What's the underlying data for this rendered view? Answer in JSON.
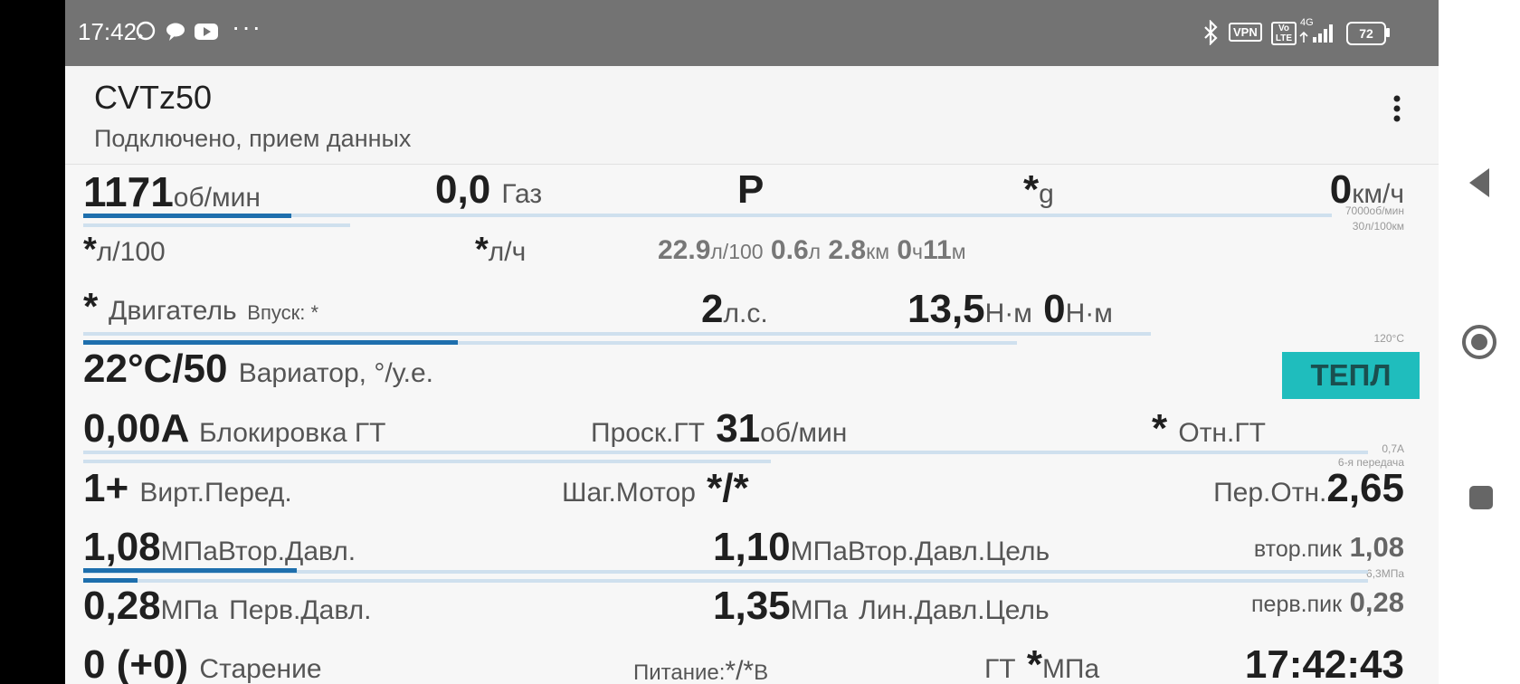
{
  "status": {
    "time": "17:42",
    "vpn": "VPN",
    "volte": "Vo LTE",
    "net": "4G",
    "battery": "72"
  },
  "app": {
    "title": "CVTz50",
    "subtitle": "Подключено, прием данных"
  },
  "row1": {
    "rpm": "1171",
    "rpm_unit": "об/мин",
    "gas": "0,0",
    "gas_label": "Газ",
    "gear": "P",
    "g_val": "*",
    "g_unit": "g",
    "speed": "0",
    "speed_unit": "км/ч",
    "scale1": "7000об/мин",
    "scale2": "30л/100км",
    "rpm_fill": 0.167
  },
  "row2": {
    "cons1": "*",
    "cons1_unit": "л/100",
    "cons2": "*",
    "cons2_unit": "л/ч",
    "trip_cons": "22.9",
    "trip_cons_unit": "л/100",
    "trip_fuel": "0.6",
    "trip_fuel_unit": "л",
    "trip_dist": "2.8",
    "trip_dist_unit": "км",
    "trip_h": "0",
    "trip_h_unit": "ч",
    "trip_m": "11",
    "trip_m_unit": "м"
  },
  "row3": {
    "engine_val": "*",
    "engine_label": "Двигатель",
    "intake": "Впуск: *",
    "hp": "2",
    "hp_unit": "л.с.",
    "torque": "13,5",
    "torque_unit": "Н·м",
    "torque2": "0",
    "torque2_unit": "Н·м",
    "scale": "120°C",
    "fill": 0.3
  },
  "row4": {
    "cvt_temp": "22°C/50",
    "cvt_label": "Вариатор, °/у.е.",
    "badge": "ТЕПЛ",
    "badge_color": "#1fbdbd"
  },
  "row5": {
    "lock_val": "0,00A",
    "lock_label": "Блокировка ГТ",
    "slip_label": "Проск.ГТ",
    "slip_val": "31",
    "slip_unit": "об/мин",
    "ratio_val": "*",
    "ratio_label": "Отн.ГТ",
    "scale1": "0,7A",
    "scale2": "6-я передача"
  },
  "row6": {
    "virt_val": "1+",
    "virt_label": "Вирт.Перед.",
    "step_label": "Шаг.Мотор",
    "step_val": "*/*",
    "per_label": "Пер.Отн.",
    "per_val": "2,65"
  },
  "row7": {
    "sec_val": "1,08",
    "sec_unit": "МПа",
    "sec_label": "Втор.Давл.",
    "sect_val": "1,10",
    "sect_unit": "МПа",
    "sect_label": "Втор.Давл.Цель",
    "peak_label": "втор.пик",
    "peak_val": "1,08",
    "scale": "6,3МПа",
    "fill": 0.171
  },
  "row8": {
    "pri_val": "0,28",
    "pri_unit": "МПа",
    "pri_label": "Перв.Давл.",
    "line_val": "1,35",
    "line_unit": "МПа",
    "line_label": "Лин.Давл.Цель",
    "peak_label": "перв.пик",
    "peak_val": "0,28"
  },
  "row9": {
    "age_val": "0 (+0)",
    "age_label": "Старение",
    "power_label": "Питание:",
    "power_val": "*/*",
    "power_unit": "В",
    "gt_label": "ГТ",
    "gt_val": "*",
    "gt_unit": "МПа",
    "clock": "17:42:43"
  },
  "colors": {
    "accent": "#1e6fad",
    "track": "#cfe0ee",
    "badge": "#1fbdbd"
  }
}
